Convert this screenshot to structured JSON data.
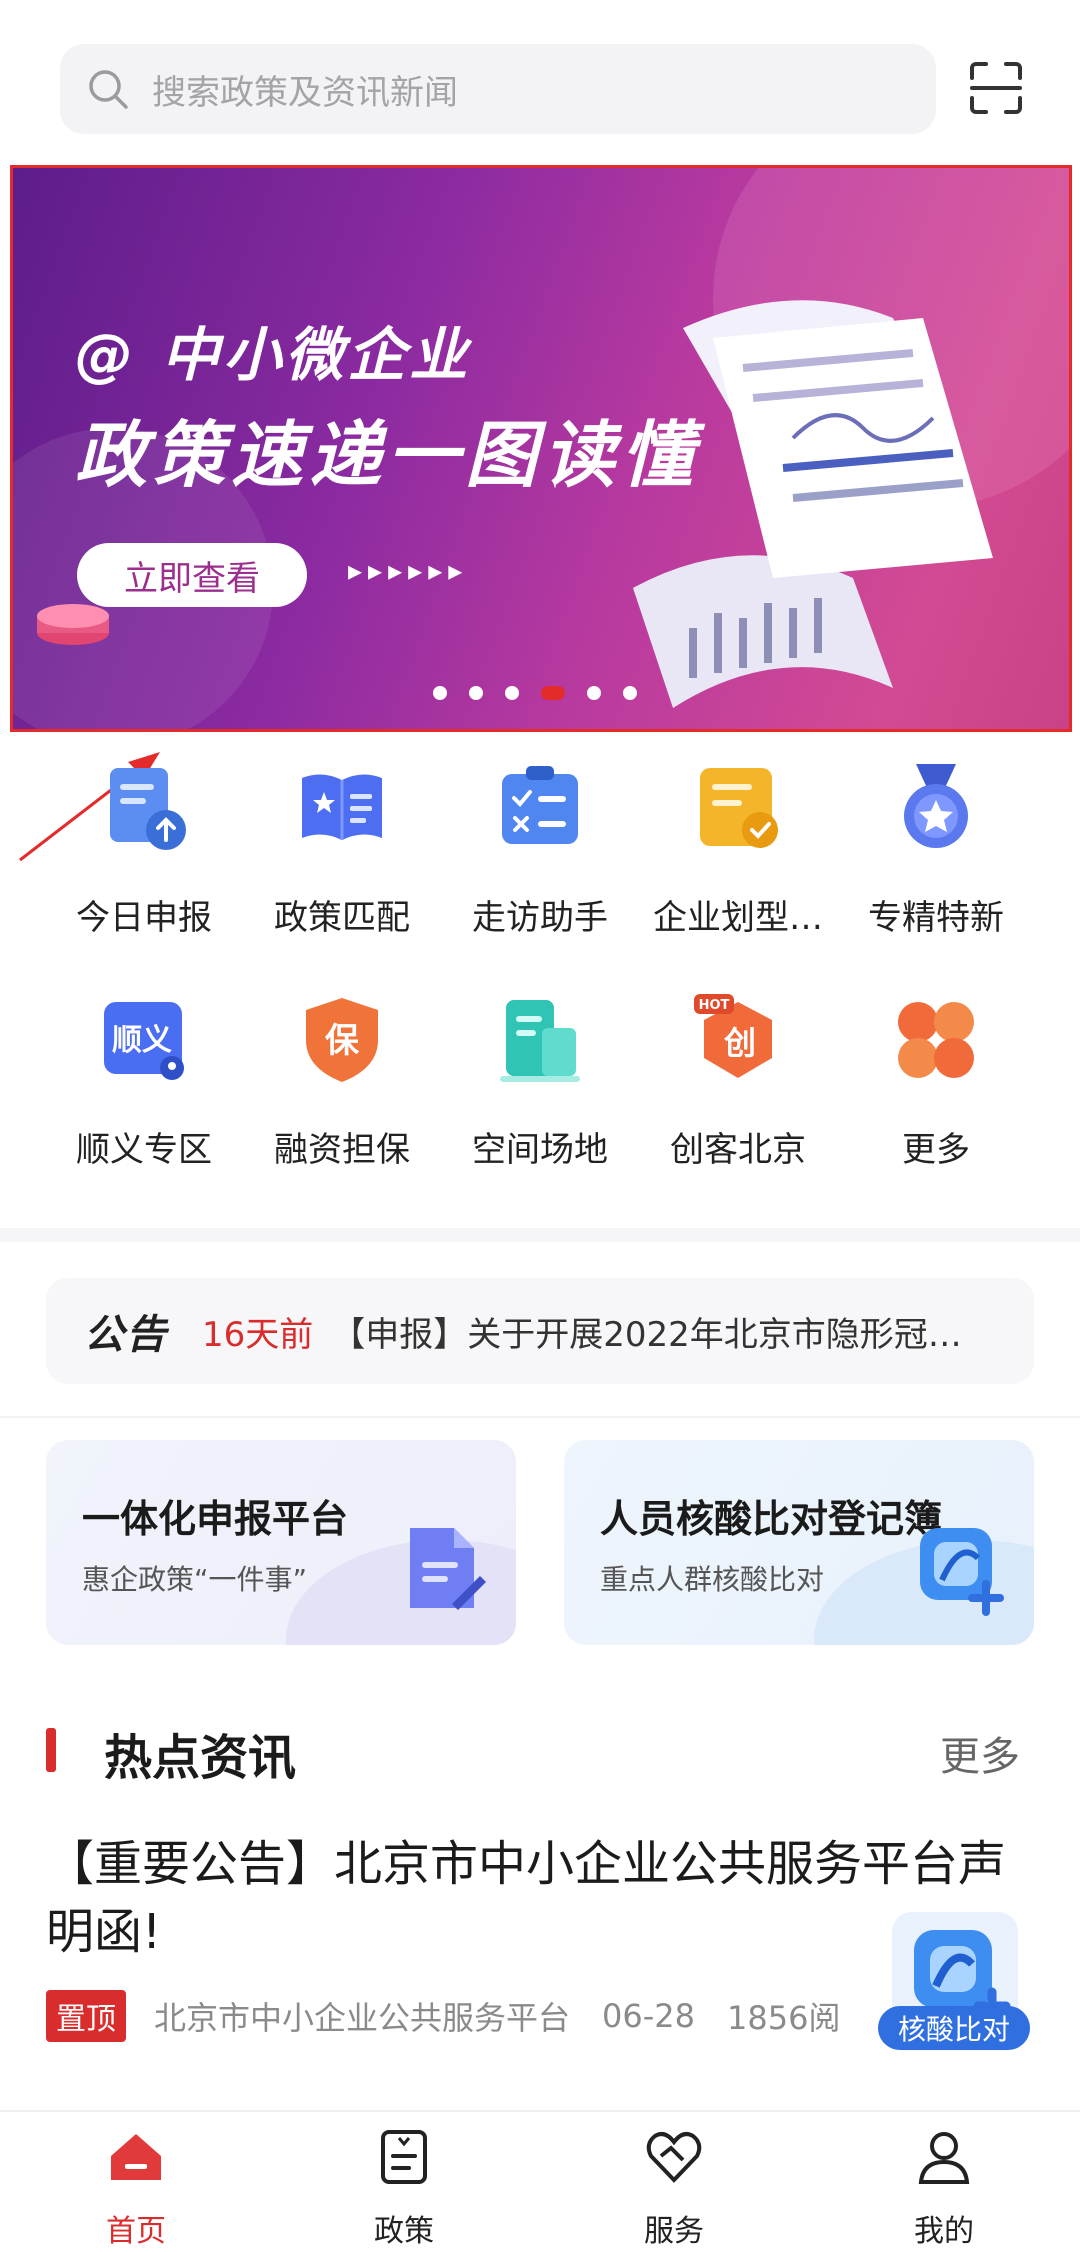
{
  "search": {
    "placeholder": "搜索政策及资讯新闻"
  },
  "banner": {
    "title_line1": "@ 中小微企业",
    "title_line2": "政策速递一图读懂",
    "button_label": "立即查看",
    "arrows": "▸▸▸▸▸▸",
    "slide_count": 6,
    "active_slide": 4
  },
  "quick_grid": [
    {
      "label": "今日申报",
      "icon": "report-upload-icon"
    },
    {
      "label": "政策匹配",
      "icon": "policy-book-icon"
    },
    {
      "label": "走访助手",
      "icon": "checklist-clipboard-icon"
    },
    {
      "label": "企业划型…",
      "icon": "enterprise-classify-icon"
    },
    {
      "label": "专精特新",
      "icon": "medal-star-icon"
    },
    {
      "label": "顺义专区",
      "icon": "shunyi-zone-icon"
    },
    {
      "label": "融资担保",
      "icon": "finance-shield-icon"
    },
    {
      "label": "空间场地",
      "icon": "space-building-icon"
    },
    {
      "label": "创客北京",
      "icon": "maker-hot-icon",
      "badge": "HOT"
    },
    {
      "label": "更多",
      "icon": "more-grid-icon"
    }
  ],
  "notice": {
    "tag": "公告",
    "time": "16天前",
    "text": "【申报】关于开展2022年北京市隐形冠…"
  },
  "cards": [
    {
      "title": "一体化申报平台",
      "subtitle": "惠企政策“一件事”",
      "icon": "document-edit-icon"
    },
    {
      "title": "人员核酸比对登记簿",
      "subtitle": "重点人群核酸比对",
      "icon": "nucleic-compare-icon"
    }
  ],
  "hot_news": {
    "title": "热点资讯",
    "more": "更多",
    "items": [
      {
        "title": "【重要公告】北京市中小企业公共服务平台声明函!",
        "tag": "置顶",
        "source": "北京市中小企业公共服务平台",
        "date": "06-28",
        "reads": "1856阅"
      }
    ]
  },
  "float_button": {
    "label": "核酸比对"
  },
  "tabbar": {
    "items": [
      {
        "label": "首页",
        "icon": "home-icon",
        "active": true
      },
      {
        "label": "政策",
        "icon": "policy-icon",
        "active": false
      },
      {
        "label": "服务",
        "icon": "service-heart-icon",
        "active": false
      },
      {
        "label": "我的",
        "icon": "user-icon",
        "active": false
      }
    ]
  },
  "colors": {
    "accent": "#d92d2d",
    "blue": "#2f6fe0",
    "banner_start": "#5d1d8a",
    "banner_end": "#d24a93"
  }
}
